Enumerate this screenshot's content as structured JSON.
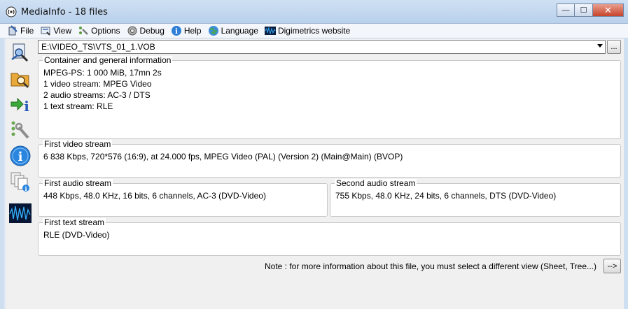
{
  "window": {
    "title": "MediaInfo - 18 files",
    "minimize": "—",
    "maximize": "☐",
    "close": "✕"
  },
  "menu": [
    {
      "label": "File",
      "icon": "file-icon"
    },
    {
      "label": "View",
      "icon": "view-icon"
    },
    {
      "label": "Options",
      "icon": "options-icon"
    },
    {
      "label": "Debug",
      "icon": "debug-icon"
    },
    {
      "label": "Help",
      "icon": "help-icon"
    },
    {
      "label": "Language",
      "icon": "language-icon"
    },
    {
      "label": "Digimetrics website",
      "icon": "digimetrics-icon"
    }
  ],
  "sidebar": [
    {
      "name": "open-file-icon"
    },
    {
      "name": "open-folder-icon"
    },
    {
      "name": "export-icon"
    },
    {
      "name": "preferences-icon"
    },
    {
      "name": "about-icon"
    },
    {
      "name": "multiple-files-icon"
    },
    {
      "name": "digimetrics-waveform-icon"
    }
  ],
  "file_select": {
    "value": "E:\\VIDEO_TS\\VTS_01_1.VOB",
    "browse_label": "..."
  },
  "panels": {
    "general": {
      "title": "Container and general information",
      "lines": [
        "MPEG-PS: 1 000 MiB, 17mn 2s",
        "1 video stream: MPEG Video",
        "2 audio streams: AC-3 / DTS",
        "1 text stream: RLE"
      ]
    },
    "video": {
      "title": "First video stream",
      "text": "6 838 Kbps, 720*576 (16:9), at 24.000 fps, MPEG Video (PAL) (Version 2) (Main@Main) (BVOP)"
    },
    "audio1": {
      "title": "First audio stream",
      "text": "448 Kbps, 48.0 KHz, 16 bits, 6 channels, AC-3 (DVD-Video)"
    },
    "audio2": {
      "title": "Second audio stream",
      "text": "755 Kbps, 48.0 KHz, 24 bits, 6 channels, DTS (DVD-Video)"
    },
    "text": {
      "title": "First text stream",
      "text": "RLE (DVD-Video)"
    }
  },
  "note": "Note : for more information about this file, you must select a different view (Sheet, Tree...)",
  "more_button": "-->"
}
